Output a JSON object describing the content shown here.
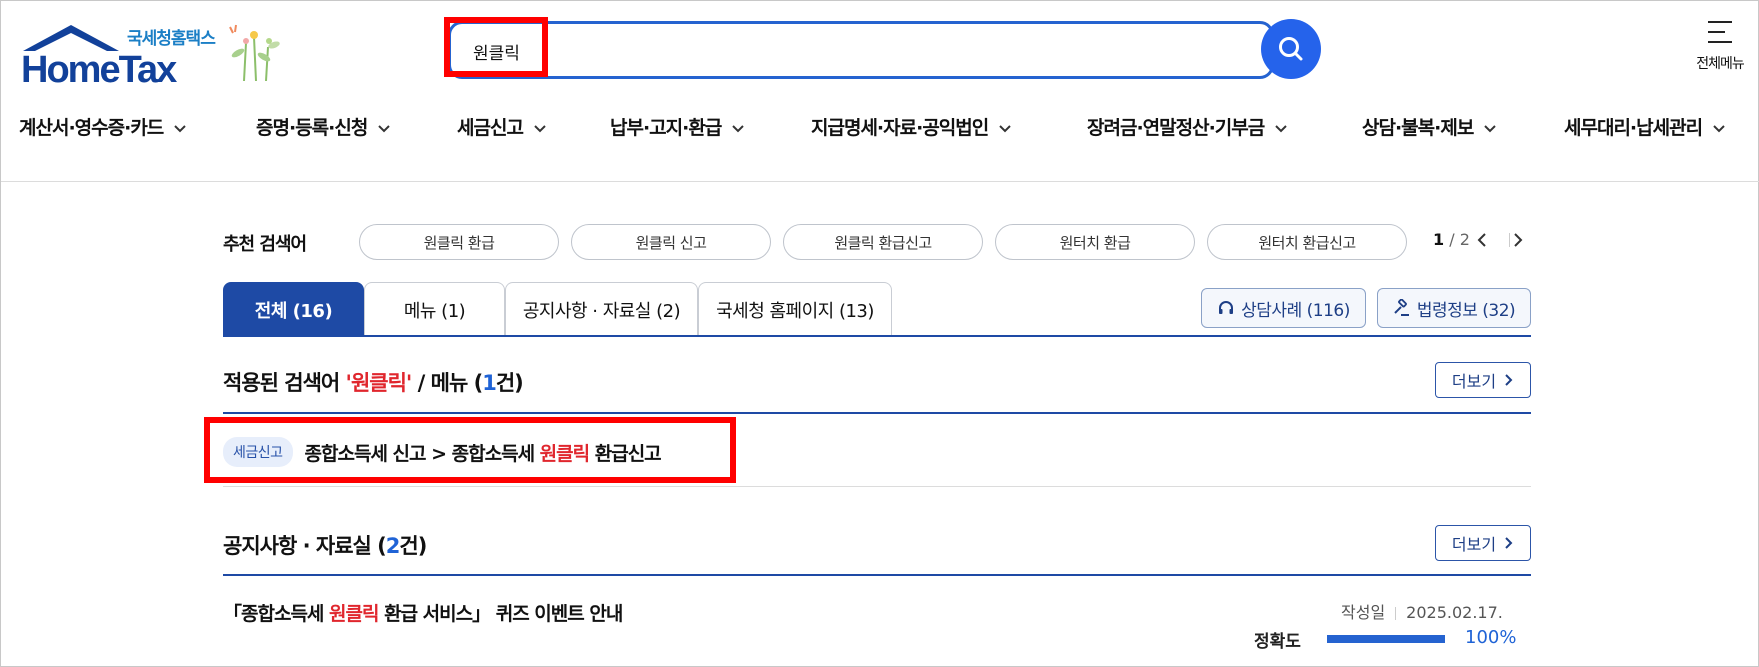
{
  "header": {
    "logo_tagline": "국세청홈택스",
    "logo_wordmark": "HomeTax",
    "search_value": "원클릭",
    "all_menu_label": "전체메뉴"
  },
  "gnb": [
    "계산서·영수증·카드",
    "증명·등록·신청",
    "세금신고",
    "납부·고지·환급",
    "지급명세·자료·공익법인",
    "장려금·연말정산·기부금",
    "상담·불복·제보",
    "세무대리·납세관리"
  ],
  "recommended": {
    "label": "추천 검색어",
    "chips": [
      "원클릭 환급",
      "원클릭 신고",
      "원클릭 환급신고",
      "원터치 환급",
      "원터치 환급신고"
    ],
    "page_current": "1",
    "page_total": "/ 2"
  },
  "tabs": {
    "items": [
      "전체 (16)",
      "메뉴 (1)",
      "공지사항 · 자료실 (2)",
      "국세청 홈페이지 (13)"
    ],
    "active_index": 0,
    "consult_label": "상담사례 (116)",
    "law_label": "법령정보 (32)"
  },
  "menu_section": {
    "prefix": "적용된 검색어 ",
    "keyword": "'원클릭'",
    "mid": " / 메뉴 (",
    "count": "1",
    "suffix": "건)",
    "more_label": "더보기",
    "result_badge": "세금신고",
    "result_path_before": "종합소득세 신고 > 종합소득세 ",
    "result_keyword": "원클릭",
    "result_path_after": " 환급신고"
  },
  "notice_section": {
    "title_before": "공지사항 · 자료실 (",
    "count": "2",
    "title_after": "건)",
    "more_label": "더보기",
    "item_title_before": "「종합소득세 ",
    "item_keyword": "원클릭",
    "item_title_after": " 환급 서비스」 퀴즈 이벤트 안내",
    "date_label": "작성일",
    "date_value": "2025.02.17.",
    "accuracy_label": "정확도",
    "accuracy_value": "100%",
    "accuracy_fraction": 1.0
  },
  "colors": {
    "primary": "#1e4aa5",
    "search_blue": "#2563eb",
    "highlight_red": "#e0262d",
    "annotation_red": "#ff0000"
  }
}
